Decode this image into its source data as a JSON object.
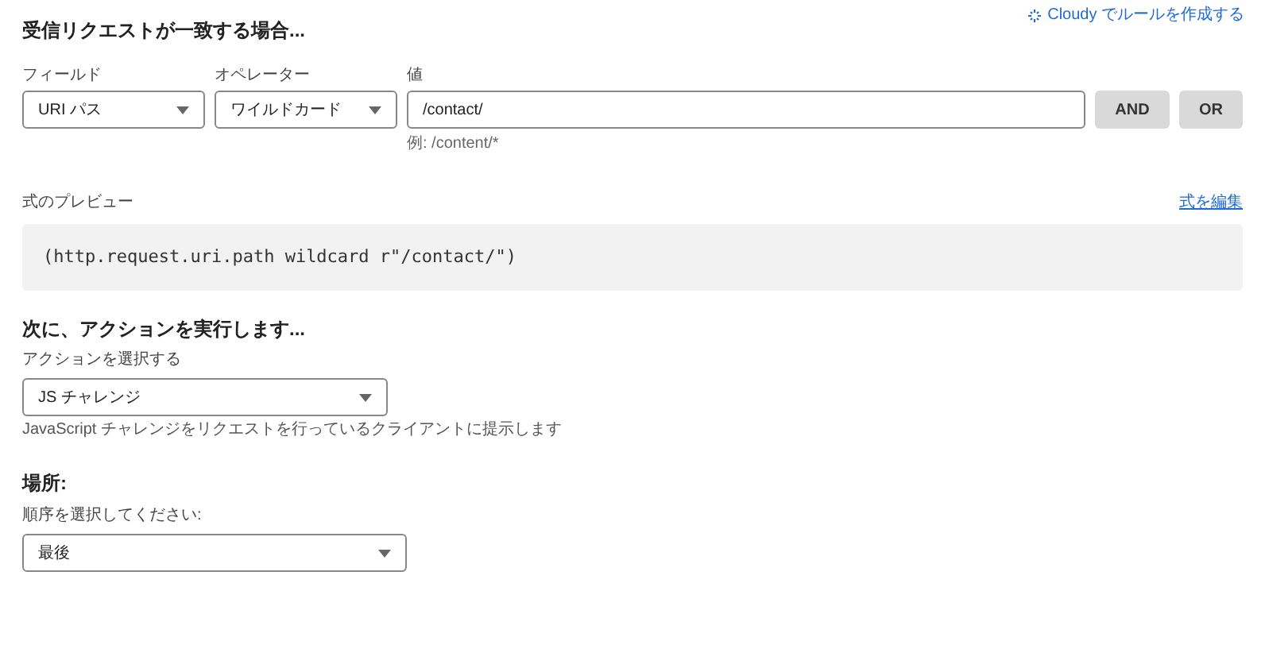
{
  "ai_link": "Cloudy でルールを作成する",
  "match_section": {
    "title": "受信リクエストが一致する場合...",
    "field": {
      "label": "フィールド",
      "value": "URI パス"
    },
    "operator": {
      "label": "オペレーター",
      "value": "ワイルドカード"
    },
    "value": {
      "label": "値",
      "value": "/contact/",
      "hint": "例: /content/*"
    },
    "buttons": [
      "AND",
      "OR"
    ]
  },
  "preview": {
    "label": "式のプレビュー",
    "edit_link": "式を編集",
    "expression": "(http.request.uri.path wildcard r\"/contact/\")"
  },
  "action_section": {
    "title": "次に、アクションを実行します...",
    "label": "アクションを選択する",
    "value": "JS チャレンジ",
    "help": "JavaScript チャレンジをリクエストを行っているクライアントに提示します"
  },
  "place_section": {
    "title": "場所:",
    "label": "順序を選択してください:",
    "value": "最後"
  }
}
